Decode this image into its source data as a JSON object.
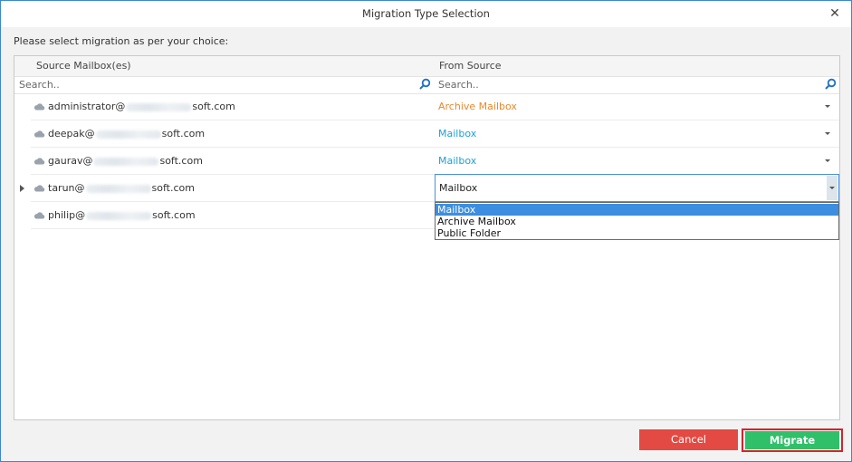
{
  "window": {
    "title": "Migration Type Selection",
    "close_icon": "close-icon"
  },
  "prompt": "Please select migration as per your choice:",
  "grid": {
    "columns": [
      "Source Mailbox(es)",
      "From Source"
    ],
    "filters": [
      {
        "placeholder": "Search..",
        "icon": "search-icon"
      },
      {
        "placeholder": "Search..",
        "icon": "search-icon"
      }
    ],
    "rows": [
      {
        "user": "administrator@",
        "domain_suffix": "soft.com",
        "type": "Archive Mailbox",
        "type_color": "#e8892b"
      },
      {
        "user": "deepak@",
        "domain_suffix": "soft.com",
        "type": "Mailbox",
        "type_color": "#1e9fd8"
      },
      {
        "user": "gaurav@",
        "domain_suffix": "soft.com",
        "type": "Mailbox",
        "type_color": "#1e9fd8"
      },
      {
        "user": "tarun@",
        "domain_suffix": "soft.com",
        "type": "Mailbox",
        "type_color": "#222222"
      },
      {
        "user": "philip@",
        "domain_suffix": "soft.com",
        "type": "",
        "type_color": "#222222"
      }
    ],
    "active_row_index": 3
  },
  "dropdown": {
    "selected_value": "Mailbox",
    "options": [
      "Mailbox",
      "Archive Mailbox",
      "Public Folder"
    ],
    "highlighted_index": 0
  },
  "buttons": {
    "cancel_label": "Cancel",
    "migrate_label": "Migrate"
  },
  "colors": {
    "cancel": "#e24a43",
    "migrate": "#2fc069",
    "migrate_outline": "#d3242a",
    "accent": "#3d8ee0"
  }
}
